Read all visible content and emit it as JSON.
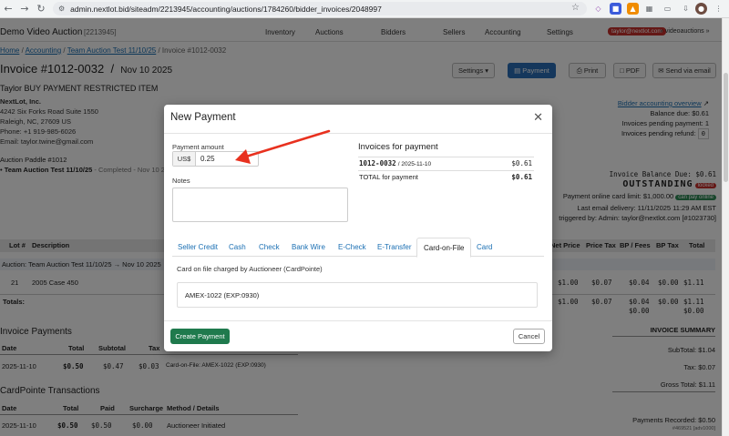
{
  "browser": {
    "url": "admin.nextlot.bid/siteadm/2213945/accounting/auctions/1784260/bidder_invoices/2048997"
  },
  "topnav": {
    "brand": "Demo Video Auction",
    "brand_id": "[2213945]",
    "items": [
      "Inventory",
      "Auctions",
      "Bidders",
      "Sellers",
      "Accounting",
      "Settings"
    ],
    "user": "taylor@nextlot.com",
    "org": "» videoauctions »"
  },
  "breadcrumb": {
    "home": "Home",
    "accounting": "Accounting",
    "auction": "Team Auction Test 11/10/25",
    "current": "Invoice #1012-0032"
  },
  "invoice": {
    "title": "Invoice #1012-0032",
    "date": "Nov 10 2025",
    "subtitle": "Taylor BUY PAYMENT RESTRICTED ITEM",
    "company": "NextLot, Inc.",
    "address1": "4242 Six Forks Road Suite 1550",
    "address2": "Raleigh, NC, 27609 US",
    "phone": "Phone: +1 919-985-6026",
    "email": "Email: taylor.twine@gmail.com",
    "paddle": "Auction Paddle #1012",
    "auction_line": "Team Auction Test 11/10/25",
    "auction_status": "- Completed - Nov 10 2"
  },
  "toolbar": {
    "settings": "Settings",
    "payment": "Payment",
    "print": "Print",
    "pdf": "PDF",
    "email": "Send via email"
  },
  "account": {
    "overview_link": "Bidder accounting overview",
    "balance_due": "Balance due: $0.61",
    "pending_payment": "Invoices pending payment: 1",
    "pending_refund": "Invoices pending refund:",
    "pending_refund_val": "0",
    "invoice_balance": "Invoice Balance Due: $0.61",
    "status": "OUTSTANDING",
    "locked": "locked",
    "card_limit": "Payment online card limit: $1,000.00",
    "can_pay": "can pay online",
    "last_email": "Last email delivery: 11/11/2025 11:29 AM EST",
    "triggered": "triggered by: Admin: taylor@nextlot.com [#1023730]"
  },
  "items_table": {
    "headers": [
      "Lot #",
      "Description",
      "Net Price",
      "Price Tax",
      "BP / Fees",
      "BP Tax",
      "Total"
    ],
    "auction_row": "Auction: Team Auction Test 11/10/25 → Nov 10 2025",
    "row": {
      "lot": "21",
      "desc": "2005 Case 450",
      "net": "$1.00",
      "tax": "$0.07",
      "bp": "$0.04",
      "bptax": "$0.00",
      "total": "$1.11"
    },
    "totals_label": "Totals:",
    "totals": {
      "net": "$1.00",
      "tax": "$0.07",
      "bp": "$0.04",
      "bp2": "$0.00",
      "bptax": "$0.00",
      "total": "$1.11",
      "total2": "$0.00"
    }
  },
  "payments_table": {
    "title": "Invoice Payments",
    "headers": [
      "Date",
      "Total",
      "Subtotal",
      "Tax",
      "Method"
    ],
    "row": {
      "date": "2025-11-10",
      "total": "$0.50",
      "subtotal": "$0.47",
      "tax": "$0.03",
      "method": "Card-on-File: AMEX-1022 (EXP:0930)"
    }
  },
  "cardpointe": {
    "title": "CardPointe Transactions",
    "headers": [
      "Date",
      "Total",
      "Paid",
      "Surcharge",
      "Method / Details"
    ],
    "row": {
      "date": "2025-11-10",
      "total": "$0.50",
      "paid": "$0.50",
      "surcharge": "$0.00",
      "method": "Auctioneer Initiated"
    }
  },
  "summary": {
    "title": "INVOICE SUMMARY",
    "subtotal": "SubTotal: $1.04",
    "tax": "Tax: $0.07",
    "gross": "Gross Total: $1.11",
    "recorded": "Payments Recorded: $0.50",
    "footer": "#469521 [adv1000]"
  },
  "modal": {
    "title": "New Payment",
    "amount_label": "Payment amount",
    "currency": "US$",
    "amount_value": "0.25",
    "notes_label": "Notes",
    "invoices_title": "Invoices for payment",
    "invoice_number": "1012-0032",
    "invoice_date": "/ 2025-11-10",
    "invoice_amount": "$0.61",
    "total_label": "TOTAL for payment",
    "total_amount": "$0.61",
    "tabs": [
      "Seller Credit",
      "Cash",
      "Check",
      "Bank Wire",
      "E-Check",
      "E-Transfer",
      "Card-on-File",
      "Card"
    ],
    "cof_note": "Card on file charged by Auctioneer (CardPointe)",
    "card_option": "AMEX-1022 (EXP:0930)",
    "create_label": "Create Payment",
    "cancel_label": "Cancel"
  },
  "colors": {
    "accent": "#2a6fb8",
    "create_button": "#1f7a4d",
    "annotation_arrow": "#e8311f"
  }
}
